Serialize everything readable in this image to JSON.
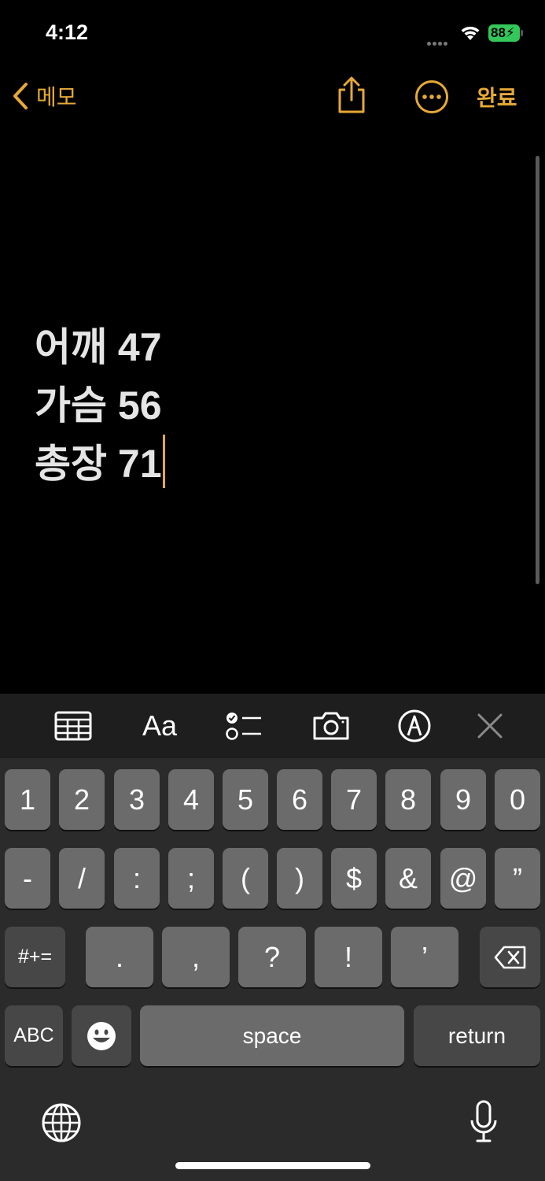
{
  "status_bar": {
    "time": "4:12",
    "battery": "88"
  },
  "nav": {
    "back_label": "메모",
    "done_label": "완료"
  },
  "note": {
    "lines": [
      "어깨 47",
      "가슴 56",
      "총장 71"
    ]
  },
  "toolbar": {
    "format_label": "Aa"
  },
  "keyboard": {
    "row1": [
      "1",
      "2",
      "3",
      "4",
      "5",
      "6",
      "7",
      "8",
      "9",
      "0"
    ],
    "row2": [
      "-",
      "/",
      ":",
      ";",
      "(",
      ")",
      "$",
      "&",
      "@",
      "”"
    ],
    "row3": {
      "shift": "#+=",
      "keys": [
        ".",
        ",",
        "?",
        "!",
        "’"
      ]
    },
    "row4": {
      "abc": "ABC",
      "space": "space",
      "return": "return"
    }
  },
  "colors": {
    "accent": "#e6a935",
    "battery": "#34c759"
  }
}
